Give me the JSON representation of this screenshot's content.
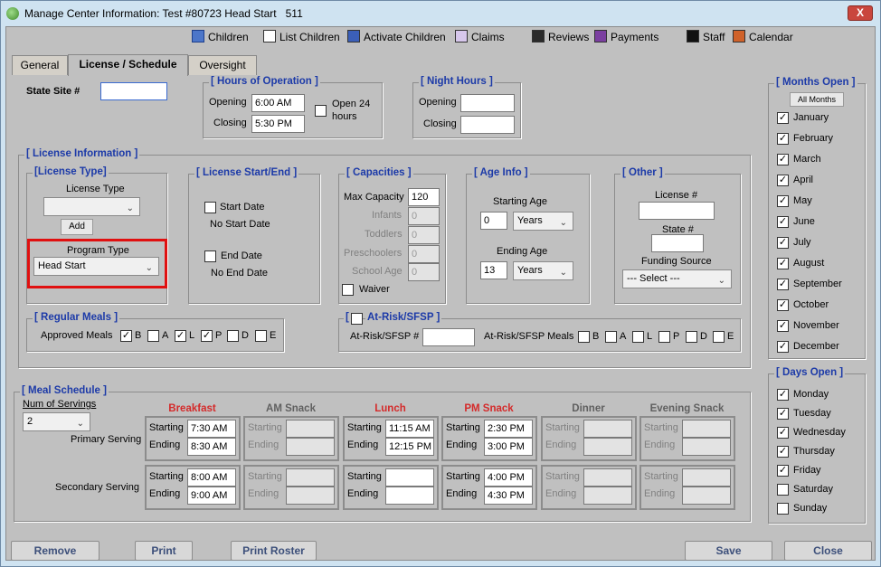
{
  "window": {
    "title": "Manage Center Information: Test #80723 Head Start   511",
    "close": "X"
  },
  "toolbar": [
    "Children",
    "List Children",
    "Activate Children",
    "Claims",
    "Reviews",
    "Payments",
    "Staff",
    "Calendar"
  ],
  "tabs": [
    "General",
    "License / Schedule",
    "Oversight"
  ],
  "state_site": {
    "label": "State Site #",
    "value": ""
  },
  "hours": {
    "title": "[ Hours of Operation ]",
    "opening_label": "Opening",
    "opening": "6:00 AM",
    "closing_label": "Closing",
    "closing": "5:30 PM",
    "open24": "Open 24 hours",
    "open24_a": "Open 24",
    "open24_b": "hours"
  },
  "night": {
    "title": "[ Night Hours ]",
    "opening_label": "Opening",
    "opening": "",
    "closing_label": "Closing",
    "closing": ""
  },
  "license_info": {
    "title": "[ License Information ]"
  },
  "license_type": {
    "title": "[License Type]",
    "label": "License Type",
    "value": "",
    "add": "Add",
    "program_label": "Program Type",
    "program_value": "Head Start"
  },
  "license_dates": {
    "title": "[ License Start/End ]",
    "start_label": "Start Date",
    "start_value": "No Start Date",
    "end_label": "End Date",
    "end_value": "No End Date"
  },
  "capacities": {
    "title": "[ Capacities ]",
    "max_label": "Max Capacity",
    "max": "120",
    "infants_label": "Infants",
    "infants": "0",
    "toddlers_label": "Toddlers",
    "toddlers": "0",
    "preschoolers_label": "Preschoolers",
    "preschoolers": "0",
    "schoolage_label": "School Age",
    "schoolage": "0",
    "waiver": "Waiver"
  },
  "age": {
    "title": "[ Age Info ]",
    "start_label": "Starting Age",
    "start": "0",
    "start_unit": "Years",
    "end_label": "Ending Age",
    "end": "13",
    "end_unit": "Years"
  },
  "other": {
    "title": "[ Other ]",
    "license_label": "License #",
    "license": "",
    "state_label": "State #",
    "state": "",
    "funding_label": "Funding Source",
    "funding": "--- Select ---"
  },
  "regular_meals": {
    "title": "[ Regular Meals ]",
    "label": "Approved Meals",
    "items": [
      {
        "l": "B",
        "c": true
      },
      {
        "l": "A",
        "c": false
      },
      {
        "l": "L",
        "c": true
      },
      {
        "l": "P",
        "c": true
      },
      {
        "l": "D",
        "c": false
      },
      {
        "l": "E",
        "c": false
      }
    ]
  },
  "atrisk": {
    "title": "At-Risk/SFSP ]",
    "open": "[",
    "num_label": "At-Risk/SFSP #",
    "num": "",
    "meals_label": "At-Risk/SFSP Meals",
    "items": [
      "B",
      "A",
      "L",
      "P",
      "D",
      "E"
    ]
  },
  "months": {
    "title": "[ Months Open ]",
    "all": "All Months",
    "list": [
      "January",
      "February",
      "March",
      "April",
      "May",
      "June",
      "July",
      "August",
      "September",
      "October",
      "November",
      "December"
    ]
  },
  "days": {
    "title": "[ Days Open ]",
    "list": [
      {
        "d": "Monday",
        "c": true
      },
      {
        "d": "Tuesday",
        "c": true
      },
      {
        "d": "Wednesday",
        "c": true
      },
      {
        "d": "Thursday",
        "c": true
      },
      {
        "d": "Friday",
        "c": true
      },
      {
        "d": "Saturday",
        "c": false
      },
      {
        "d": "Sunday",
        "c": false
      }
    ]
  },
  "schedule": {
    "title": "[ Meal Schedule ]",
    "num_label": "Num of Servings",
    "num": "2",
    "primary": "Primary Serving",
    "secondary": "Secondary Serving",
    "starting": "Starting",
    "ending": "Ending",
    "meals": [
      {
        "name": "Breakfast",
        "active": true,
        "p_start": "7:30 AM",
        "p_end": "8:30 AM",
        "s_start": "8:00 AM",
        "s_end": "9:00 AM"
      },
      {
        "name": "AM Snack",
        "active": false,
        "p_start": "",
        "p_end": "",
        "s_start": "",
        "s_end": ""
      },
      {
        "name": "Lunch",
        "active": true,
        "p_start": "11:15 AM",
        "p_end": "12:15 PM",
        "s_start": "",
        "s_end": ""
      },
      {
        "name": "PM Snack",
        "active": true,
        "p_start": "2:30 PM",
        "p_end": "3:00 PM",
        "s_start": "4:00 PM",
        "s_end": "4:30 PM"
      },
      {
        "name": "Dinner",
        "active": false,
        "p_start": "",
        "p_end": "",
        "s_start": "",
        "s_end": ""
      },
      {
        "name": "Evening Snack",
        "active": false,
        "p_start": "",
        "p_end": "",
        "s_start": "",
        "s_end": ""
      }
    ]
  },
  "buttons": {
    "remove": "Remove",
    "print": "Print",
    "print_roster": "Print Roster",
    "save": "Save",
    "close": "Close"
  }
}
